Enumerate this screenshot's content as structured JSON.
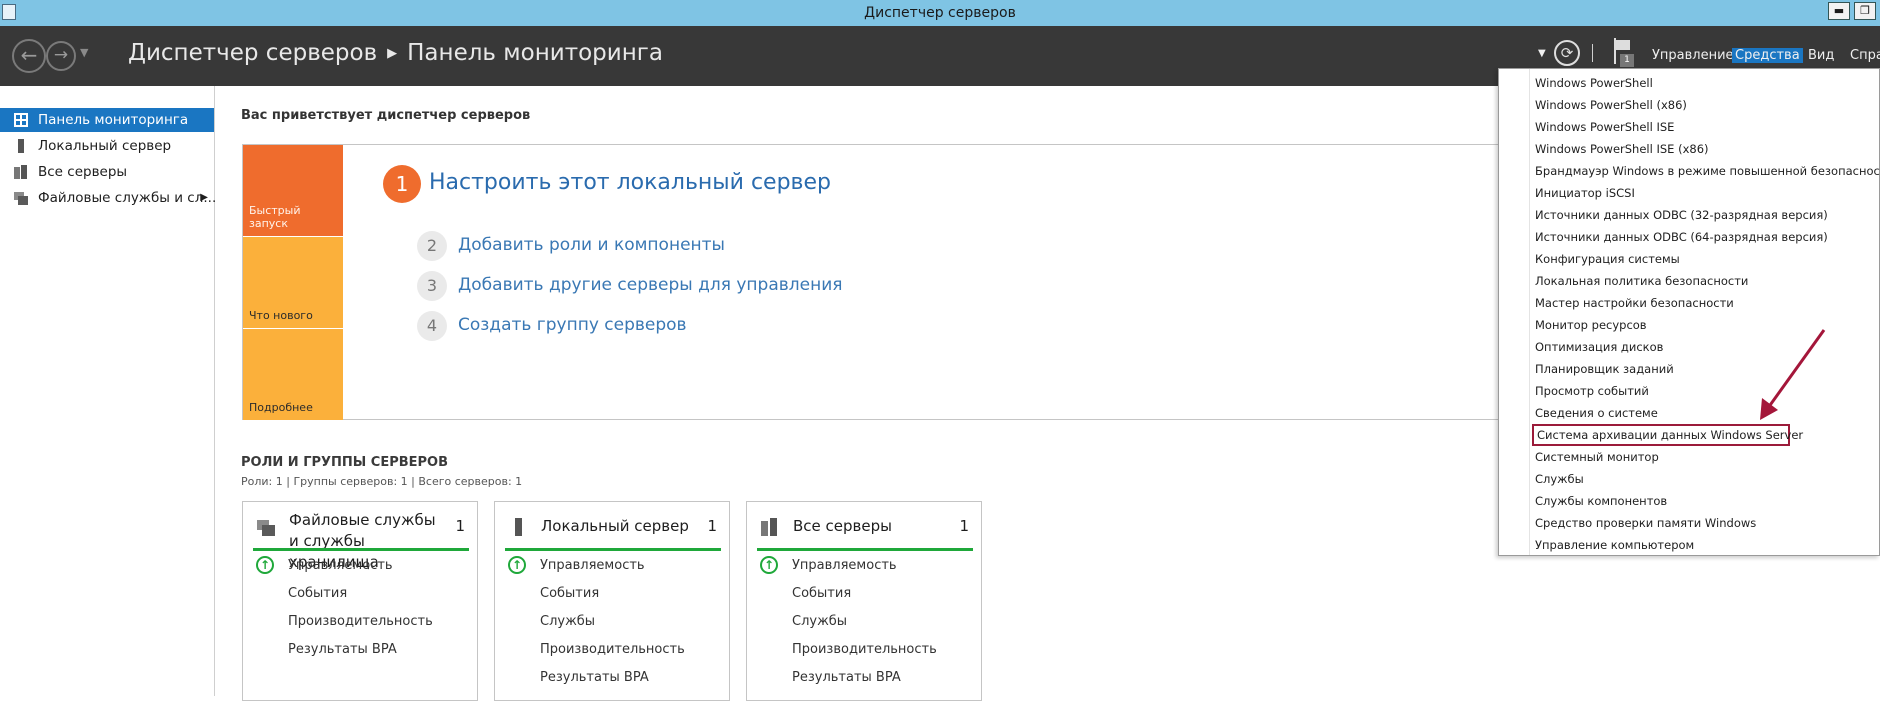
{
  "window": {
    "title": "Диспетчер серверов",
    "min_glyph": "▬",
    "restore_glyph": "❐"
  },
  "header": {
    "breadcrumb_root": "Диспетчер серверов",
    "breadcrumb_sep": "▶",
    "breadcrumb_page": "Панель мониторинга",
    "back_glyph": "←",
    "forward_glyph": "→",
    "dropdown_glyph": "▼",
    "refresh_glyph": "⟳",
    "notification_count": "1",
    "menu": {
      "manage": "Управление",
      "tools": "Средства",
      "view": "Вид",
      "help": "Спра"
    }
  },
  "sidebar": {
    "items": [
      {
        "label": "Панель мониторинга",
        "icon": "dashboard-icon"
      },
      {
        "label": "Локальный сервер",
        "icon": "server-icon"
      },
      {
        "label": "Все серверы",
        "icon": "servers-icon"
      },
      {
        "label": "Файловые службы и сл...",
        "icon": "file-services-icon"
      }
    ],
    "expand_glyph": "▶"
  },
  "main": {
    "welcome": "Вас приветствует диспетчер серверов",
    "tiles": [
      "Быстрый запуск",
      "Что нового",
      "Подробнее"
    ],
    "steps": [
      {
        "num": "1",
        "label": "Настроить этот локальный сервер"
      },
      {
        "num": "2",
        "label": "Добавить роли и компоненты"
      },
      {
        "num": "3",
        "label": "Добавить другие серверы для управления"
      },
      {
        "num": "4",
        "label": "Создать группу серверов"
      }
    ],
    "roles_title": "РОЛИ И ГРУППЫ СЕРВЕРОВ",
    "roles_summary": "Роли: 1 | Группы серверов: 1 | Всего серверов: 1",
    "cards": [
      {
        "title": "Файловые службы и службы хранилища",
        "count": "1",
        "rows": [
          "Управляемость",
          "События",
          "Производительность",
          "Результаты BPA"
        ]
      },
      {
        "title": "Локальный сервер",
        "count": "1",
        "rows": [
          "Управляемость",
          "События",
          "Службы",
          "Производительность",
          "Результаты BPA"
        ]
      },
      {
        "title": "Все серверы",
        "count": "1",
        "rows": [
          "Управляемость",
          "События",
          "Службы",
          "Производительность",
          "Результаты BPA"
        ]
      }
    ],
    "ok_glyph": "↑"
  },
  "tools_menu": {
    "items": [
      "Windows PowerShell",
      "Windows PowerShell (x86)",
      "Windows PowerShell ISE",
      "Windows PowerShell ISE (x86)",
      "Брандмауэр Windows в режиме повышенной безопасности",
      "Инициатор iSCSI",
      "Источники данных ODBC (32-разрядная версия)",
      "Источники данных ODBC (64-разрядная версия)",
      "Конфигурация системы",
      "Локальная политика безопасности",
      "Мастер настройки безопасности",
      "Монитор ресурсов",
      "Оптимизация дисков",
      "Планировщик заданий",
      "Просмотр событий",
      "Сведения о системе",
      "Система архивации данных Windows Server",
      "Системный монитор",
      "Службы",
      "Службы компонентов",
      "Средство проверки памяти Windows",
      "Управление компьютером"
    ],
    "highlighted_index": 16,
    "highlight_color": "#9b1b3a"
  },
  "colors": {
    "accent": "#1a76c2",
    "header_bg": "#383838",
    "titlebar": "#7fc4e4",
    "orange": "#ef6c2d",
    "amber": "#fbb03b",
    "ok_green": "#1fa83a"
  }
}
